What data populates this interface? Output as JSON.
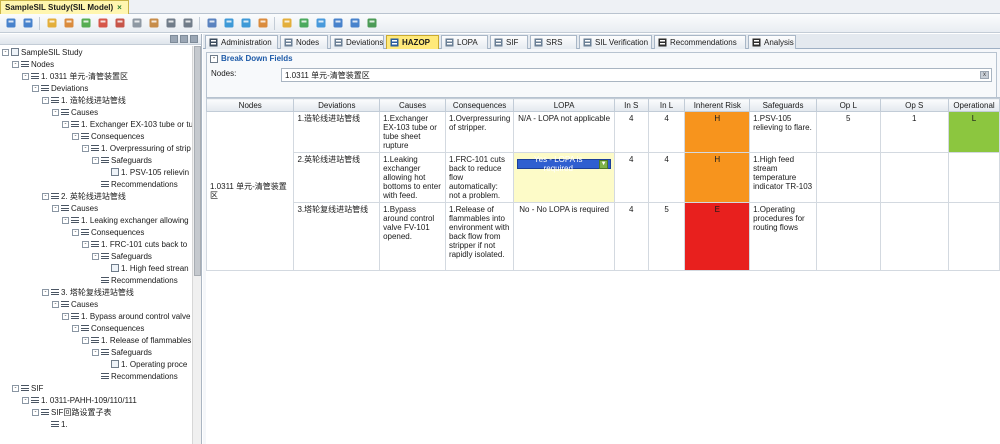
{
  "app": {
    "doc_tab": "SampleSIL Study(SIL Model)",
    "doc_tab_close": "×"
  },
  "toolbar": {
    "icons": [
      "save-icon",
      "save-all-icon",
      "new-doc-icon",
      "edit-icon",
      "add-icon",
      "delete-icon",
      "cut-icon",
      "copy-icon",
      "paste-icon",
      "move-up-icon",
      "move-down-icon",
      "import-icon",
      "grid-icon",
      "window-icon",
      "export-icon",
      "tools-icon",
      "run-icon",
      "refresh-icon",
      "sync-icon",
      "dropdown-icon",
      "excel-icon"
    ]
  },
  "tree": {
    "items": [
      {
        "label": "SampleSIL Study",
        "level": 0,
        "exp": "-",
        "icon": "doc"
      },
      {
        "label": "Nodes",
        "level": 1,
        "exp": "-",
        "icon": "list"
      },
      {
        "label": "1. 0311 单元-清管装置区",
        "level": 2,
        "exp": "-",
        "icon": "list"
      },
      {
        "label": "Deviations",
        "level": 3,
        "exp": "-",
        "icon": "list"
      },
      {
        "label": "1. 造轮线进站管线",
        "level": 4,
        "exp": "-",
        "icon": "list"
      },
      {
        "label": "Causes",
        "level": 5,
        "exp": "-",
        "icon": "list"
      },
      {
        "label": "1. Exchanger EX-103 tube or tu",
        "level": 6,
        "exp": "-",
        "icon": "list"
      },
      {
        "label": "Consequences",
        "level": 7,
        "exp": "-",
        "icon": "list"
      },
      {
        "label": "1. Overpressuring of strip",
        "level": 8,
        "exp": "-",
        "icon": "list"
      },
      {
        "label": "Safeguards",
        "level": 9,
        "exp": "-",
        "icon": "list"
      },
      {
        "label": "1. PSV-105 relievin",
        "level": 10,
        "exp": "",
        "icon": "doc"
      },
      {
        "label": "Recommendations",
        "level": 9,
        "exp": "",
        "icon": "list"
      },
      {
        "label": "2. 英轮线进站管线",
        "level": 4,
        "exp": "-",
        "icon": "list"
      },
      {
        "label": "Causes",
        "level": 5,
        "exp": "-",
        "icon": "list"
      },
      {
        "label": "1. Leaking exchanger allowing",
        "level": 6,
        "exp": "-",
        "icon": "list"
      },
      {
        "label": "Consequences",
        "level": 7,
        "exp": "-",
        "icon": "list"
      },
      {
        "label": "1. FRC-101 cuts back to",
        "level": 8,
        "exp": "-",
        "icon": "list"
      },
      {
        "label": "Safeguards",
        "level": 9,
        "exp": "-",
        "icon": "list"
      },
      {
        "label": "1. High feed strean",
        "level": 10,
        "exp": "",
        "icon": "doc"
      },
      {
        "label": "Recommendations",
        "level": 9,
        "exp": "",
        "icon": "list"
      },
      {
        "label": "3. 塔轮复线进站管线",
        "level": 4,
        "exp": "-",
        "icon": "list"
      },
      {
        "label": "Causes",
        "level": 5,
        "exp": "-",
        "icon": "list"
      },
      {
        "label": "1. Bypass around control valve",
        "level": 6,
        "exp": "-",
        "icon": "list"
      },
      {
        "label": "Consequences",
        "level": 7,
        "exp": "-",
        "icon": "list"
      },
      {
        "label": "1. Release of flammables",
        "level": 8,
        "exp": "-",
        "icon": "list"
      },
      {
        "label": "Safeguards",
        "level": 9,
        "exp": "-",
        "icon": "list"
      },
      {
        "label": "1. Operating proce",
        "level": 10,
        "exp": "",
        "icon": "doc"
      },
      {
        "label": "Recommendations",
        "level": 9,
        "exp": "",
        "icon": "list"
      },
      {
        "label": "SIF",
        "level": 1,
        "exp": "-",
        "icon": "list"
      },
      {
        "label": "1. 0311-PAHH-109/110/111",
        "level": 2,
        "exp": "-",
        "icon": "list"
      },
      {
        "label": "SIF回路设置子表",
        "level": 3,
        "exp": "-",
        "icon": "list"
      },
      {
        "label": "1.",
        "level": 4,
        "exp": "",
        "icon": "list"
      }
    ]
  },
  "tabs": [
    {
      "label": "Administration",
      "icon": "admin-icon",
      "active": false
    },
    {
      "label": "Nodes",
      "icon": "nodes-icon",
      "active": false
    },
    {
      "label": "Deviations",
      "icon": "deviations-icon",
      "active": false
    },
    {
      "label": "HAZOP",
      "icon": "hazop-icon",
      "active": true
    },
    {
      "label": "LOPA",
      "icon": "lopa-icon",
      "active": false
    },
    {
      "label": "SIF",
      "icon": "sif-icon",
      "active": false
    },
    {
      "label": "SRS",
      "icon": "srs-icon",
      "active": false
    },
    {
      "label": "SIL Verification",
      "icon": "sil-verification-icon",
      "active": false
    },
    {
      "label": "Recommendations",
      "icon": "recommendations-icon",
      "active": false
    },
    {
      "label": "Analysis",
      "icon": "analysis-icon",
      "active": false
    }
  ],
  "breakdown": {
    "title": "Break Down Fields",
    "collapse": "-",
    "nodes_label": "Nodes:",
    "nodes_value": "1.0311 单元-清管装置区",
    "clear": "x"
  },
  "grid": {
    "headers": [
      "Nodes",
      "Deviations",
      "Causes",
      "Consequences",
      "LOPA",
      "In S",
      "In L",
      "Inherent Risk",
      "Safeguards",
      "Op L",
      "Op S",
      "Operational"
    ],
    "node_name": "1.0311 单元-清管装置区",
    "rows": [
      {
        "deviation": "1.造轮线进站管线",
        "cause": "1.Exchanger EX-103 tube or tube sheet rupture",
        "consequence": "1.Overpressuring of stripper.",
        "lopa": "N/A - LOPA not applicable",
        "lopa_editing": false,
        "in_s": "4",
        "in_l": "4",
        "risk": "H",
        "risk_color": "#f7941d",
        "safeguard": "1.PSV-105 relieving to flare.",
        "op_l": "5",
        "op_s": "1",
        "operational": "L",
        "operational_color": "#8cc63f"
      },
      {
        "deviation": "2.英轮线进站管线",
        "cause": "1.Leaking exchanger allowing hot bottoms to enter with feed.",
        "consequence": "1.FRC-101 cuts back to reduce flow automatically: not a problem.",
        "lopa": "Yes - LOPA is required",
        "lopa_editing": true,
        "in_s": "4",
        "in_l": "4",
        "risk": "H",
        "risk_color": "#f7941d",
        "safeguard": "1.High feed stream temperature indicator TR-103",
        "op_l": "",
        "op_s": "",
        "operational": "",
        "operational_color": "#ffffff"
      },
      {
        "deviation": "3.塔轮复线进站管线",
        "cause": "1.Bypass around control valve FV-101 opened.",
        "consequence": "1.Release of flammables into environment with back flow from stripper if not rapidly isolated.",
        "lopa": "No - No LOPA is required",
        "lopa_editing": false,
        "in_s": "4",
        "in_l": "5",
        "risk": "E",
        "risk_color": "#e8201e",
        "safeguard": "1.Operating procedures for routing flows",
        "op_l": "",
        "op_s": "",
        "operational": "",
        "operational_color": "#ffffff"
      }
    ]
  }
}
